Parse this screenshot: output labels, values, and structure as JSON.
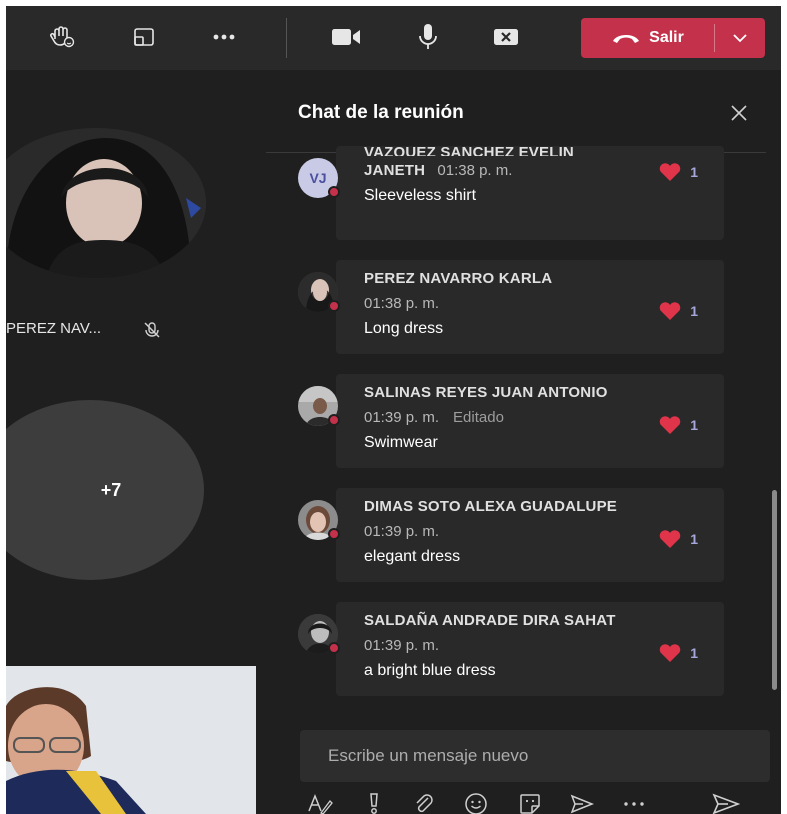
{
  "toolbar": {
    "react_icon": "raise-hand-icon",
    "layout_icon": "share-screen-icon",
    "more_icon": "more-icon",
    "camera_icon": "camera-icon",
    "mic_icon": "microphone-icon",
    "share_icon": "close-share-icon",
    "leave_label": "Salir",
    "leave_color": "#c4314b"
  },
  "stage": {
    "participant_name": "PEREZ NAV...",
    "more_participants": "+7"
  },
  "chat": {
    "title": "Chat de la reunión",
    "messages": [
      {
        "initials": "VJ",
        "name": "VAZQUEZ SANCHEZ EVELIN",
        "name_cont": "JANETH",
        "time": "01:38 p. m.",
        "edited": "",
        "text": "Sleeveless shirt",
        "reaction_count": "1"
      },
      {
        "name": "PEREZ NAVARRO KARLA",
        "time": "01:38 p. m.",
        "edited": "",
        "text": "Long dress",
        "reaction_count": "1"
      },
      {
        "name": "SALINAS REYES JUAN ANTONIO",
        "time": "01:39 p. m.",
        "edited": "Editado",
        "text": "Swimwear",
        "reaction_count": "1"
      },
      {
        "name": "DIMAS SOTO ALEXA GUADALUPE",
        "time": "01:39 p. m.",
        "edited": "",
        "text": "elegant dress",
        "reaction_count": "1"
      },
      {
        "name": "SALDAÑA ANDRADE DIRA SAHAT",
        "time": "01:39 p. m.",
        "edited": "",
        "text": "a bright blue dress",
        "reaction_count": "1"
      }
    ],
    "compose_placeholder": "Escribe un mensaje nuevo",
    "reaction_color": "#e0344b",
    "count_color": "#a6a7dc"
  }
}
